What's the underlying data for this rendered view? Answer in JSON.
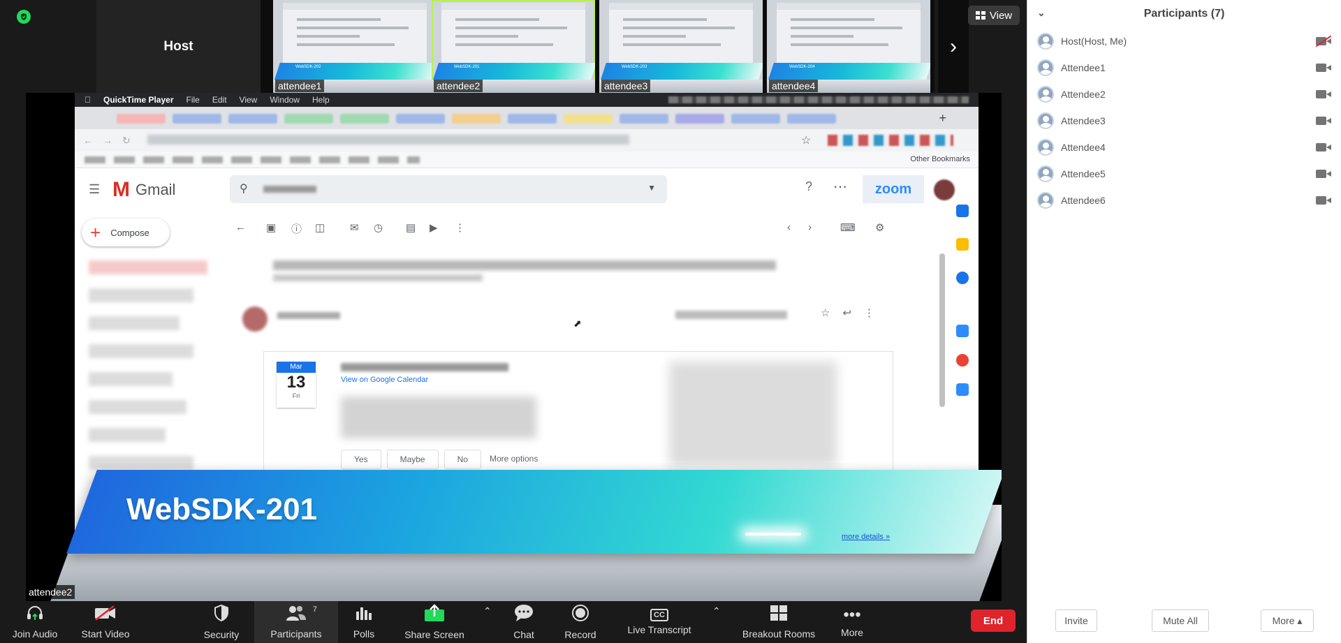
{
  "strip": {
    "host_label": "Host",
    "thumbnails": [
      {
        "name": "attendee1",
        "banner": "WebSDK-202",
        "active": false
      },
      {
        "name": "attendee2",
        "banner": "WebSDK-201",
        "active": true
      },
      {
        "name": "attendee3",
        "banner": "WebSDK-203",
        "active": false
      },
      {
        "name": "attendee4",
        "banner": "WebSDK-204",
        "active": false
      }
    ]
  },
  "view_button": {
    "label": "View"
  },
  "shared_screen": {
    "owner_label": "attendee2",
    "mac_menu": {
      "app": "QuickTime Player",
      "items": [
        "File",
        "Edit",
        "View",
        "Window",
        "Help"
      ]
    },
    "bookmarks": {
      "other": "Other Bookmarks"
    },
    "gmail": {
      "brand": "Gmail",
      "zoom_logo": "zoom",
      "compose": "Compose",
      "calendar": {
        "month": "Mar",
        "day": "13",
        "weekday": "Fri"
      },
      "invite_link": "View on Google Calendar",
      "rsvp": [
        "Yes",
        "Maybe",
        "No",
        "More options"
      ]
    },
    "banner": {
      "title": "WebSDK-201",
      "more": "more details »"
    }
  },
  "controls": {
    "join_audio": "Join Audio",
    "start_video": "Start Video",
    "security": "Security",
    "participants": "Participants",
    "participants_count": "7",
    "polls": "Polls",
    "share_screen": "Share Screen",
    "chat": "Chat",
    "record": "Record",
    "cc_icon": "CC",
    "live_transcript": "Live Transcript",
    "breakout_rooms": "Breakout Rooms",
    "more": "More",
    "end": "End"
  },
  "panel": {
    "title": "Participants (7)",
    "participants": [
      {
        "name": "Host(Host, Me)",
        "video_off": true
      },
      {
        "name": "Attendee1",
        "video_off": false
      },
      {
        "name": "Attendee2",
        "video_off": false
      },
      {
        "name": "Attendee3",
        "video_off": false
      },
      {
        "name": "Attendee4",
        "video_off": false
      },
      {
        "name": "Attendee5",
        "video_off": false
      },
      {
        "name": "Attendee6",
        "video_off": false
      }
    ],
    "footer": {
      "invite": "Invite",
      "mute_all": "Mute All",
      "more": "More ▴"
    }
  },
  "colors": {
    "end_red": "#e0242c",
    "share_green": "#23d959",
    "zoom_blue": "#2d8cff"
  }
}
